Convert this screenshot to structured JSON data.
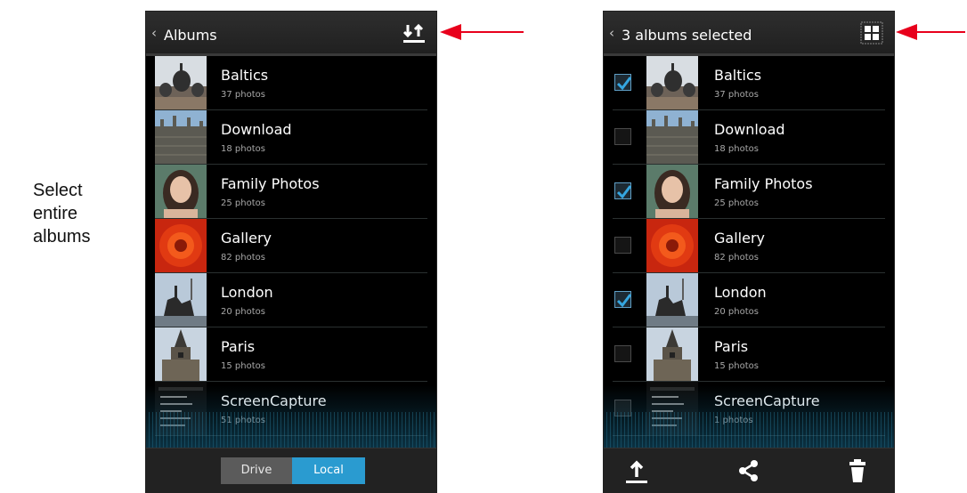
{
  "caption": {
    "line1": "Select",
    "line2": "entire",
    "line3": "albums"
  },
  "left_screen": {
    "header_title": "Albums",
    "albums": [
      {
        "name": "Baltics",
        "count": "37 photos",
        "thumb": "church-domes"
      },
      {
        "name": "Download",
        "count": "18 photos",
        "thumb": "gothic-building"
      },
      {
        "name": "Family Photos",
        "count": "25 photos",
        "thumb": "portrait"
      },
      {
        "name": "Gallery",
        "count": "82 photos",
        "thumb": "red-flower"
      },
      {
        "name": "London",
        "count": "20 photos",
        "thumb": "statue"
      },
      {
        "name": "Paris",
        "count": "15 photos",
        "thumb": "tower"
      },
      {
        "name": "ScreenCapture",
        "count": "51 photos",
        "thumb": "screenshot"
      }
    ],
    "tabs": {
      "drive": "Drive",
      "local": "Local"
    }
  },
  "right_screen": {
    "header_title": "3 albums selected",
    "albums": [
      {
        "name": "Baltics",
        "count": "37 photos",
        "checked": true
      },
      {
        "name": "Download",
        "count": "18 photos",
        "checked": false
      },
      {
        "name": "Family Photos",
        "count": "25 photos",
        "checked": true
      },
      {
        "name": "Gallery",
        "count": "82 photos",
        "checked": false
      },
      {
        "name": "London",
        "count": "20 photos",
        "checked": true
      },
      {
        "name": "Paris",
        "count": "15 photos",
        "checked": false
      },
      {
        "name": "ScreenCapture",
        "count": "1 photos",
        "checked": false
      }
    ]
  },
  "colors": {
    "accent": "#2a9bd0",
    "annotation_arrow": "#e8001c",
    "background": "#000000"
  }
}
